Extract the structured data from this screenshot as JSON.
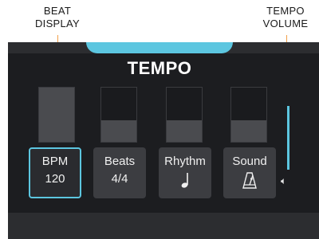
{
  "callouts": {
    "beat_display": [
      "BEAT",
      "DISPLAY"
    ],
    "tempo_volume": [
      "TEMPO",
      "VOLUME"
    ]
  },
  "screen": {
    "title": "TEMPO",
    "beat_indicators": [
      {
        "level": 1.0
      },
      {
        "level": 0.4
      },
      {
        "level": 0.4
      },
      {
        "level": 0.4
      }
    ],
    "tempo_volume_level": 1.0,
    "buttons": [
      {
        "label": "BPM",
        "value": "120",
        "active": true
      },
      {
        "label": "Beats",
        "value": "4/4",
        "active": false
      },
      {
        "label": "Rhythm",
        "icon": "quarter-note-icon",
        "active": false
      },
      {
        "label": "Sound",
        "icon": "metronome-icon",
        "active": false
      }
    ],
    "speaker_icon": "speaker-icon"
  },
  "colors": {
    "accent": "#5cc6e0",
    "leader": "#f2a04a",
    "panel": "#1c1d20",
    "button": "#3c3d41"
  }
}
